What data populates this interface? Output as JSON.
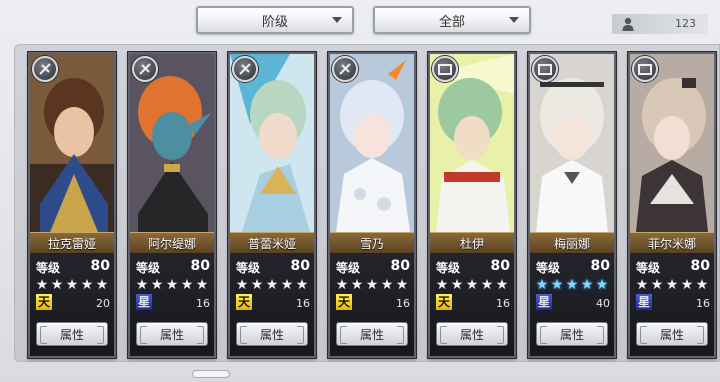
{
  "filters": {
    "rank_label": "阶级",
    "all_label": "全部"
  },
  "owned_count": "123",
  "colors": {
    "accent_gold": "#8a6a3a",
    "attr_sun": "#e6b400",
    "attr_water": "#2c36a8"
  },
  "cards": [
    {
      "name": "拉克雷娅",
      "level_label": "等级",
      "level": "80",
      "star_color": "white",
      "stars": 5,
      "attr_glyph": "天",
      "attr_icon": "sun",
      "attr_value": "20",
      "button_label": "属性"
    },
    {
      "name": "阿尔缇娜",
      "level_label": "等级",
      "level": "80",
      "star_color": "white",
      "stars": 5,
      "attr_glyph": "星",
      "attr_icon": "water",
      "attr_value": "16",
      "button_label": "属性"
    },
    {
      "name": "普蕾米娅",
      "level_label": "等级",
      "level": "80",
      "star_color": "white",
      "stars": 5,
      "attr_glyph": "天",
      "attr_icon": "sun",
      "attr_value": "16",
      "button_label": "属性"
    },
    {
      "name": "雪乃",
      "level_label": "等级",
      "level": "80",
      "star_color": "white",
      "stars": 5,
      "attr_glyph": "天",
      "attr_icon": "sun",
      "attr_value": "16",
      "button_label": "属性"
    },
    {
      "name": "杜伊",
      "level_label": "等级",
      "level": "80",
      "star_color": "white",
      "stars": 5,
      "attr_glyph": "天",
      "attr_icon": "sun",
      "attr_value": "16",
      "button_label": "属性"
    },
    {
      "name": "梅丽娜",
      "level_label": "等级",
      "level": "80",
      "star_color": "blue",
      "stars": 5,
      "attr_glyph": "星",
      "attr_icon": "water",
      "attr_value": "40",
      "button_label": "属性"
    },
    {
      "name": "菲尔米娜",
      "level_label": "等级",
      "level": "80",
      "star_color": "white",
      "stars": 5,
      "attr_glyph": "星",
      "attr_icon": "water",
      "attr_value": "16",
      "button_label": "属性"
    }
  ]
}
